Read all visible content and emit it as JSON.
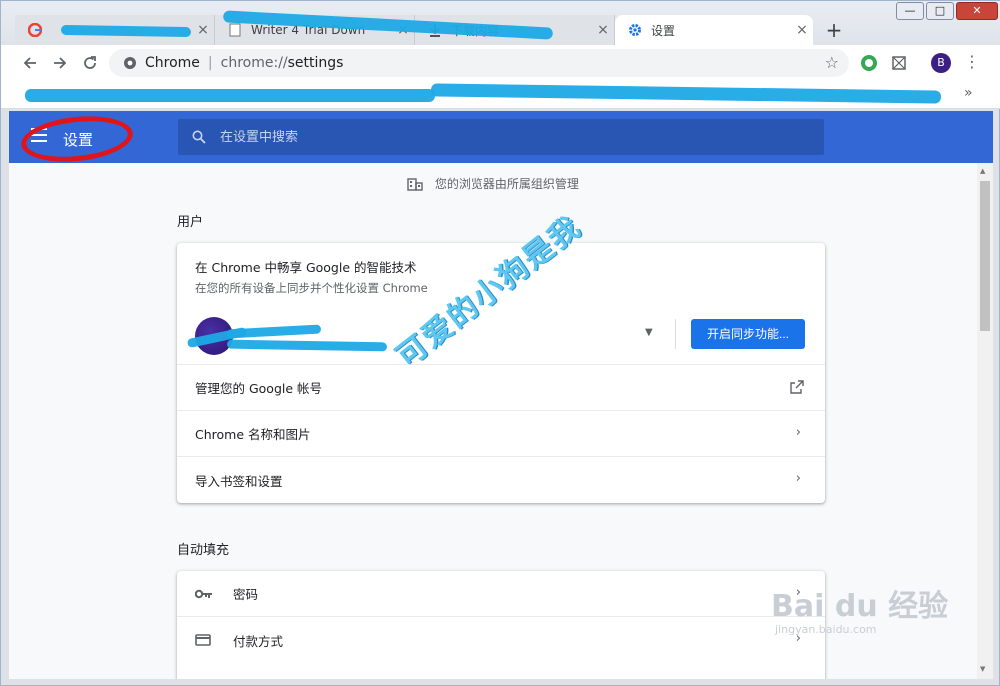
{
  "window": {
    "minimize": "—",
    "maximize": "□",
    "close": "✕"
  },
  "tabs": [
    {
      "title": "",
      "favicon": "google-icon",
      "close": "×"
    },
    {
      "title": "Writer 4 Trial Down",
      "favicon": "page-icon",
      "close": "×"
    },
    {
      "title": "下载内容",
      "favicon": "download-icon",
      "close": "×"
    },
    {
      "title": "设置",
      "favicon": "gear-icon",
      "close": "×"
    }
  ],
  "new_tab": "+",
  "omnibox": {
    "site_label": "Chrome",
    "separator": "|",
    "url_scheme": "chrome://",
    "url_path": "settings"
  },
  "bookmarks": {
    "more": "»"
  },
  "profile_initial": "B",
  "menu": "⋮",
  "settings_header": {
    "title": "设置",
    "search_placeholder": "在设置中搜索"
  },
  "managed_notice": "您的浏览器由所属组织管理",
  "people": {
    "section_title": "用户",
    "sync_title": "在 Chrome 中畅享 Google 的智能技术",
    "sync_subtitle": "在您的所有设备上同步并个性化设置 Chrome",
    "sync_button": "开启同步功能...",
    "dropdown": "▼",
    "rows": [
      {
        "label": "管理您的 Google 帐号",
        "trailing": "external-link-icon"
      },
      {
        "label": "Chrome 名称和图片",
        "trailing": "›"
      },
      {
        "label": "导入书签和设置",
        "trailing": "›"
      }
    ]
  },
  "autofill": {
    "section_title": "自动填充",
    "rows": [
      {
        "label": "密码",
        "icon": "key-icon",
        "trailing": "›"
      },
      {
        "label": "付款方式",
        "icon": "credit-card-icon",
        "trailing": "›"
      }
    ]
  },
  "watermark": "可爱的小狗是我",
  "baidu": {
    "logo": "Bai du 经验",
    "domain": "jingyan.baidu.com"
  },
  "colors": {
    "header_blue": "#3367d6",
    "search_blue": "#2a56b3",
    "button_blue": "#1a73e8",
    "annotation_red": "#e0151b",
    "scribble_blue": "#1ea9e6"
  }
}
